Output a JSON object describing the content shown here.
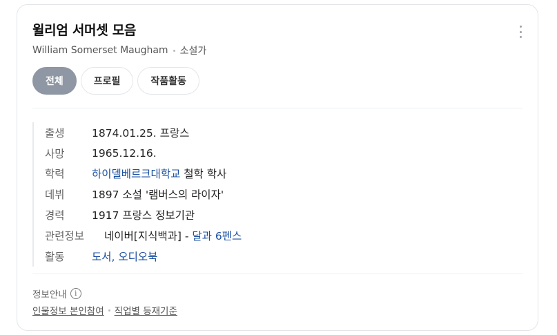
{
  "profile": {
    "title": "윌리엄 서머셋 모음",
    "name_en": "William Somerset Maugham",
    "occupation": "소설가"
  },
  "tabs": [
    {
      "label": "전체",
      "active": true
    },
    {
      "label": "프로필",
      "active": false
    },
    {
      "label": "작품활동",
      "active": false
    }
  ],
  "info": {
    "birth": {
      "label": "출생",
      "value": "1874.01.25. 프랑스"
    },
    "death": {
      "label": "사망",
      "value": "1965.12.16."
    },
    "education": {
      "label": "학력",
      "link": "하이델베르크대학교",
      "rest": "철학 학사"
    },
    "debut": {
      "label": "데뷔",
      "value": "1897 소설 '램버스의 라이자'"
    },
    "career": {
      "label": "경력",
      "value": "1917 프랑스 정보기관"
    },
    "related": {
      "label": "관련정보",
      "source": "네이버[지식백과] -",
      "link": "달과 6펜스"
    },
    "activity": {
      "label": "활동",
      "links": [
        "도서,",
        "오디오북"
      ]
    }
  },
  "footer": {
    "heading": "정보안내",
    "info_icon": "i",
    "links": [
      "인물정보 본인참여",
      "직업별 등재기준"
    ]
  },
  "colors": {
    "active_tab": "#8e97a3",
    "link": "#1a4fa0"
  },
  "icons": {
    "more": "more-vertical-icon",
    "info": "info-circle-icon"
  }
}
